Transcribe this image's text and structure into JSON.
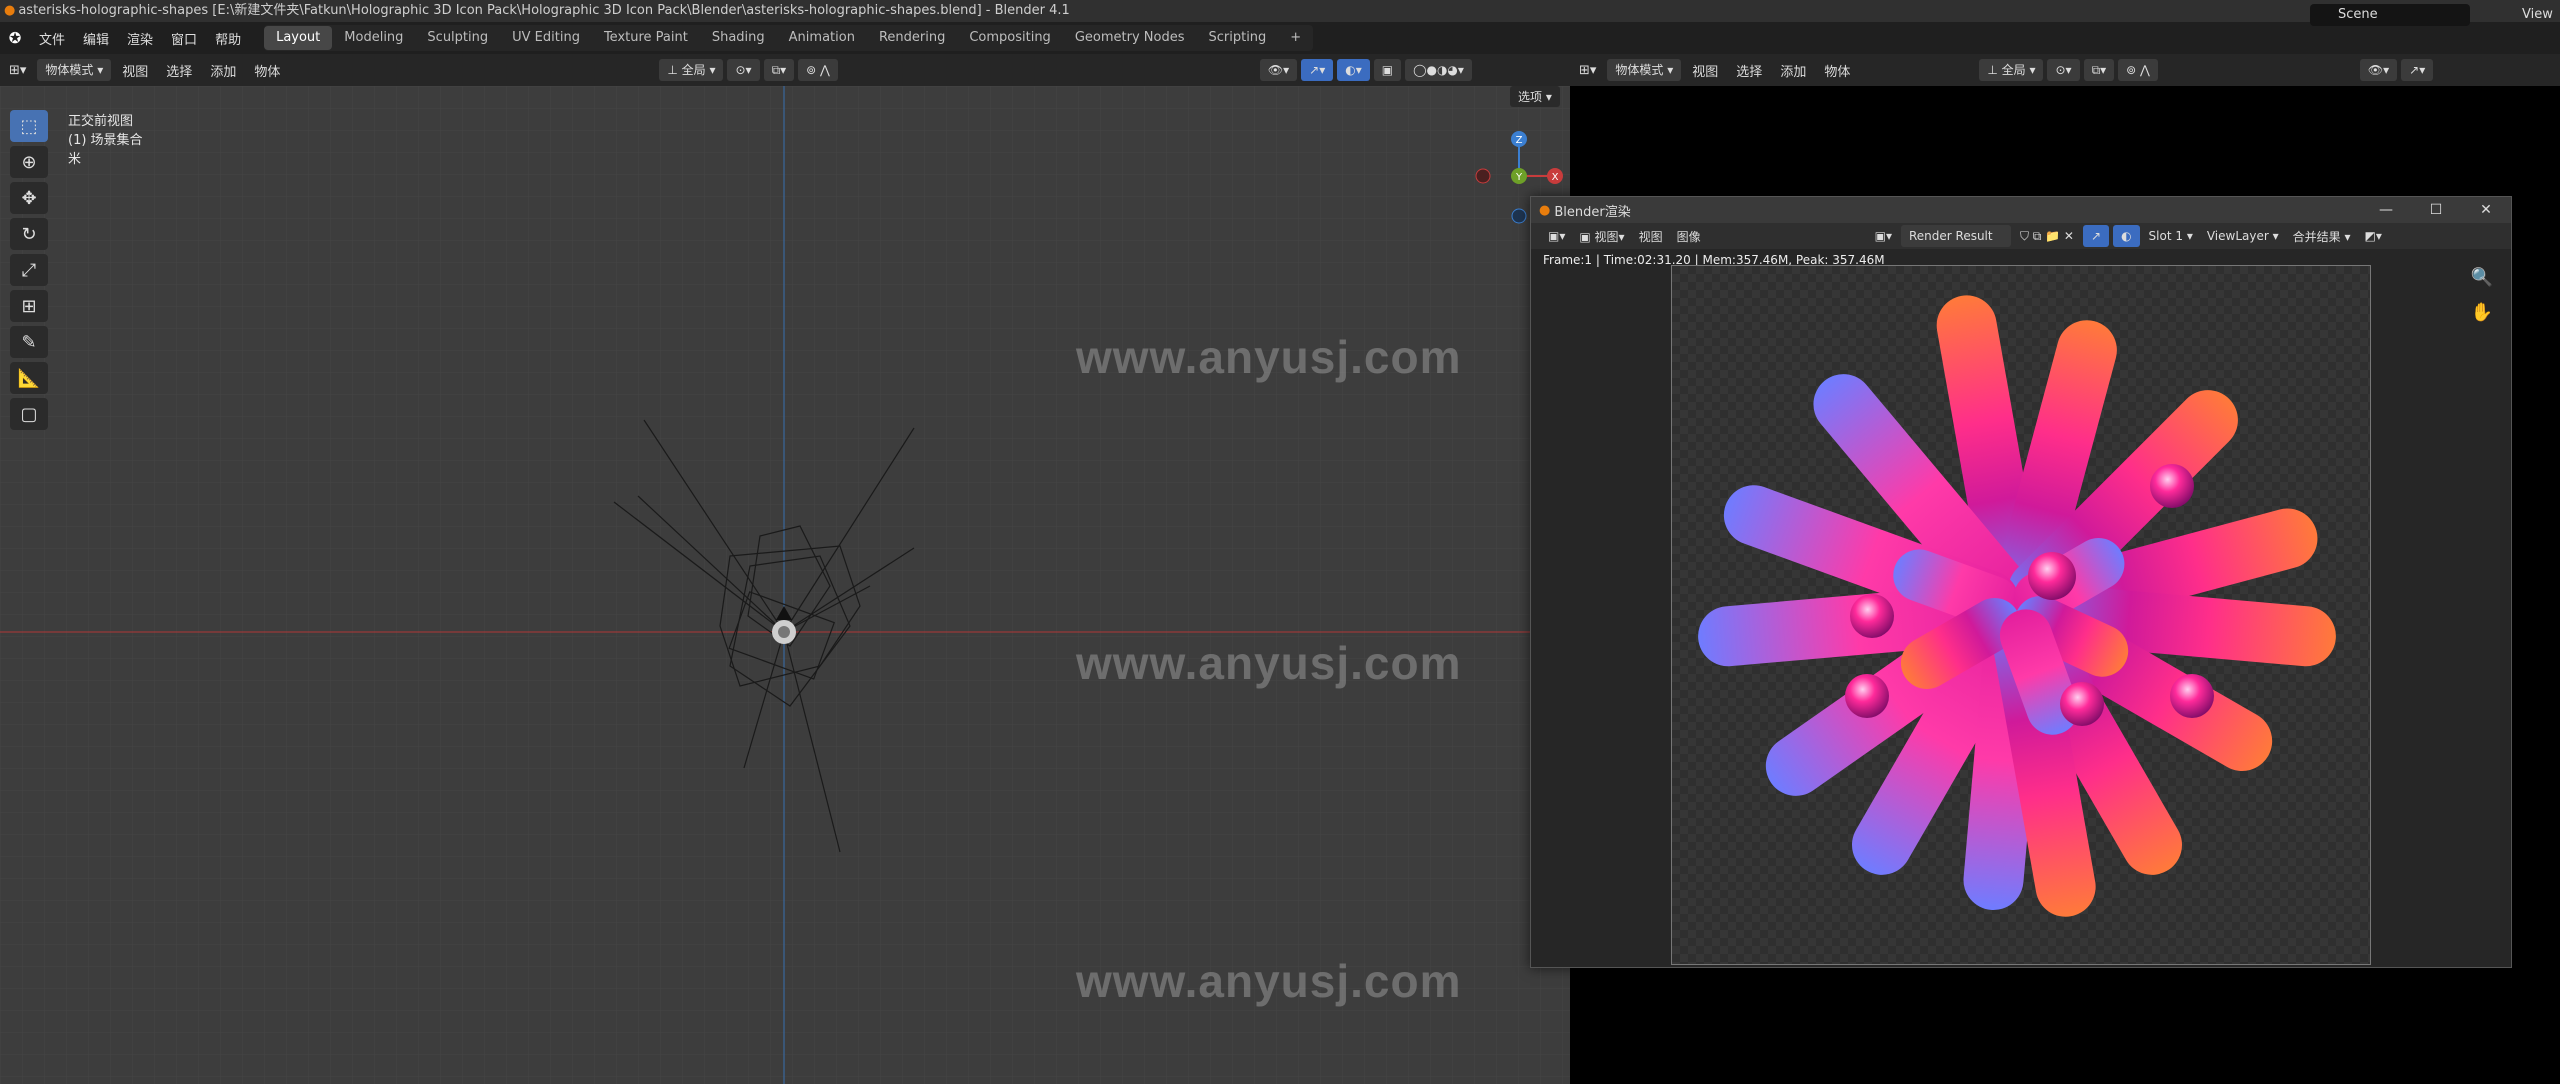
{
  "window": {
    "title": "asterisks-holographic-shapes [E:\\新建文件夹\\Fatkun\\Holographic 3D Icon Pack\\Holographic 3D Icon Pack\\Blender\\asterisks-holographic-shapes.blend] - Blender 4.1"
  },
  "menu": {
    "items": [
      "文件",
      "编辑",
      "渲染",
      "窗口",
      "帮助"
    ]
  },
  "workspaces": [
    "Layout",
    "Modeling",
    "Sculpting",
    "UV Editing",
    "Texture Paint",
    "Shading",
    "Animation",
    "Rendering",
    "Compositing",
    "Geometry Nodes",
    "Scripting"
  ],
  "active_workspace": "Layout",
  "scene": {
    "name": "Scene",
    "view_layer": "View"
  },
  "viewport_header": {
    "mode": "物体模式",
    "items": [
      "视图",
      "选择",
      "添加",
      "物体"
    ],
    "transform": "全局",
    "options": "选项"
  },
  "right_header": {
    "mode": "物体模式",
    "items": [
      "视图",
      "选择",
      "添加",
      "物体"
    ],
    "transform": "全局"
  },
  "viewport": {
    "view_name": "正交前视图",
    "collection": "(1) 场景集合",
    "unit": "米"
  },
  "gizmo": {
    "z": "Z",
    "y": "Y",
    "x": "X"
  },
  "watermark": "www.anyusj.com",
  "render_window": {
    "title": "Blender渲染",
    "menu": [
      "视图",
      "图像"
    ],
    "image_name": "Render Result",
    "slot": "Slot 1",
    "view_layer": "ViewLayer",
    "pass": "合并结果",
    "status": "Frame:1 | Time:02:31.20 | Mem:357.46M, Peak: 357.46M"
  },
  "colors": {
    "accent": "#4772b3",
    "x_axis": "#c83c3c",
    "y_axis": "#6ea028",
    "z_axis": "#3b7fd1"
  }
}
